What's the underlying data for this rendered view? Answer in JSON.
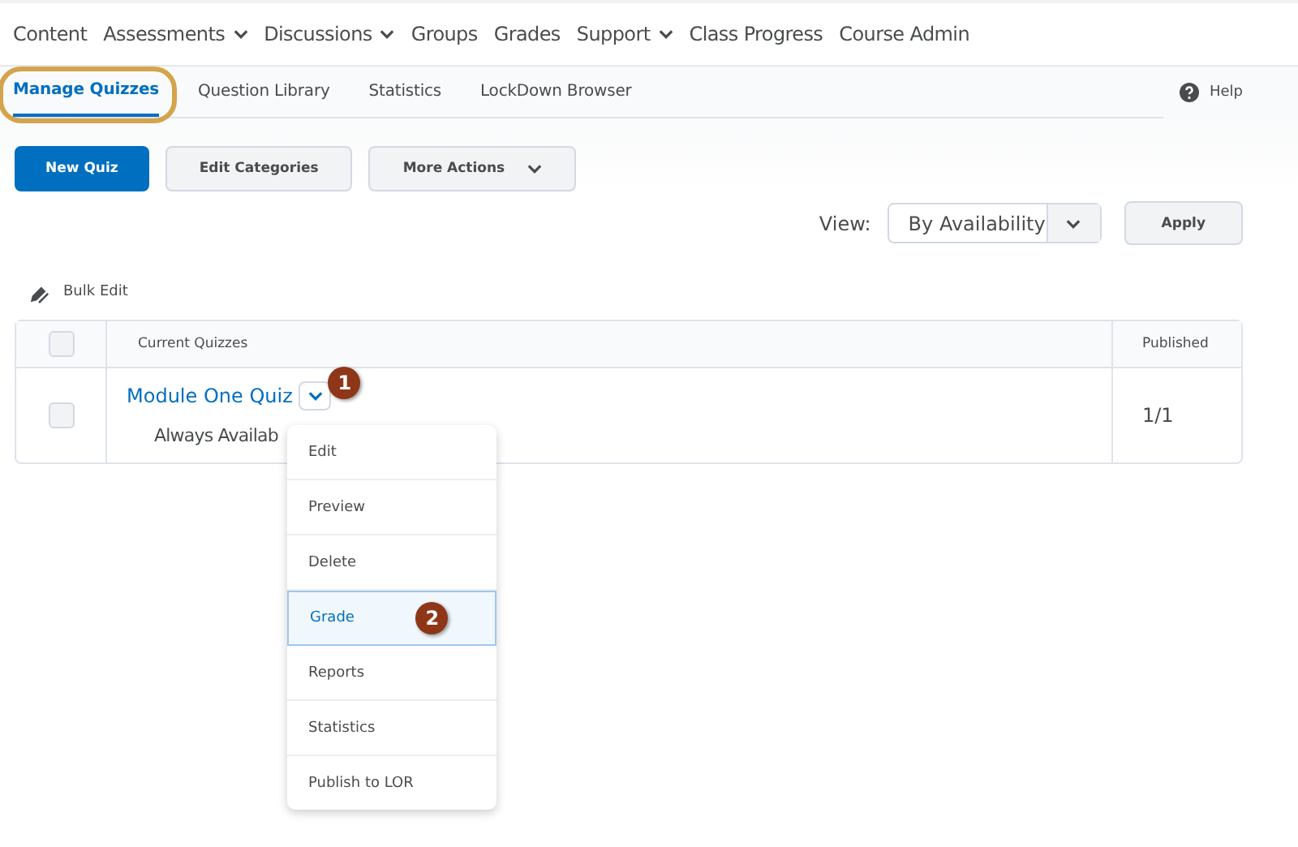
{
  "nav": [
    {
      "label": "Content",
      "has_menu": false
    },
    {
      "label": "Assessments",
      "has_menu": true
    },
    {
      "label": "Discussions",
      "has_menu": true
    },
    {
      "label": "Groups",
      "has_menu": false
    },
    {
      "label": "Grades",
      "has_menu": false
    },
    {
      "label": "Support",
      "has_menu": true
    },
    {
      "label": "Class Progress",
      "has_menu": false
    },
    {
      "label": "Course Admin",
      "has_menu": false
    }
  ],
  "tabs": [
    {
      "label": "Manage Quizzes",
      "selected": true,
      "highlighted": true
    },
    {
      "label": "Question Library",
      "selected": false,
      "highlighted": false
    },
    {
      "label": "Statistics",
      "selected": false,
      "highlighted": false
    },
    {
      "label": "LockDown Browser",
      "selected": false,
      "highlighted": false
    }
  ],
  "help": "Help",
  "buttons": [
    {
      "label": "New Quiz",
      "kind": "primary"
    },
    {
      "label": "Edit Categories",
      "kind": "plain"
    },
    {
      "label": "More Actions",
      "kind": "menu"
    }
  ],
  "view": {
    "label": "View:",
    "value": "By Availability",
    "apply": "Apply"
  },
  "bulk_edit": "Bulk Edit",
  "table": {
    "select_all_checked": false,
    "columns": [
      "Current Quizzes",
      "Published"
    ],
    "rows": [
      {
        "checked": false,
        "title": "Module One Quiz",
        "subtitle": "Always Availab",
        "published": "1/1",
        "callout": "1"
      }
    ]
  },
  "menu": [
    {
      "label": "Edit",
      "selected": false
    },
    {
      "label": "Preview",
      "selected": false
    },
    {
      "label": "Delete",
      "selected": false
    },
    {
      "label": "Grade",
      "selected": true,
      "callout": "2"
    },
    {
      "label": "Reports",
      "selected": false
    },
    {
      "label": "Statistics",
      "selected": false
    },
    {
      "label": "Publish to LOR",
      "selected": false
    }
  ]
}
